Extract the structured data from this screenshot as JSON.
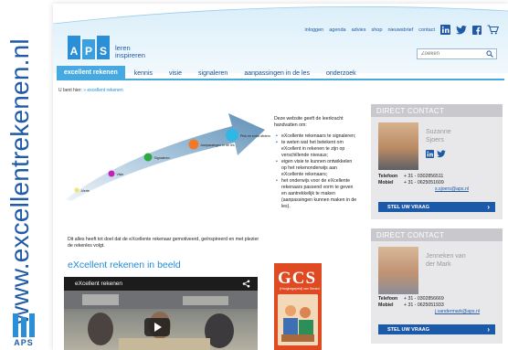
{
  "side": {
    "url": "www.excellentrekenen.nl",
    "logo_text": "APS"
  },
  "header": {
    "logo_letters": [
      "A",
      "P",
      "S"
    ],
    "logo_tagline_1": "leren",
    "logo_tagline_2": "inspireren",
    "top_links": [
      "inloggen",
      "agenda",
      "advies",
      "shop",
      "nieuwsbrief",
      "contact"
    ],
    "search_placeholder": "Zoeken"
  },
  "nav": {
    "items": [
      "excellent rekenen",
      "kennis",
      "visie",
      "signaleren",
      "aanpassingen in de les",
      "onderzoek"
    ],
    "active_index": 0
  },
  "breadcrumb": {
    "prefix": "U bent hier:",
    "link": "» excellent rekenen"
  },
  "diagram": {
    "labels": [
      "Alerte",
      "Visie",
      "Signaleren",
      "Aanpassingen in de les",
      "Plek en extra afstemde programma's"
    ],
    "colors": [
      "#f2e46a",
      "#c71fb8",
      "#2fa844",
      "#f07a2a",
      "#2fb8e6"
    ]
  },
  "intro": {
    "lead": "Deze website geeft de leerkracht handvatten om:",
    "bullets": [
      "eXcellente rekenaars te signaleren;",
      "te weten wat het betekent om eXcellent in rekenen te zijn op verschillende niveaus;",
      "eigen visie te kunnen ontwikkelen op het rekenonderwijs aan eXcellente rekenaars;",
      "het onderwijs voor de eXcellente rekenaars passend vorm te geven en aantrekkelijk te maken (aanpassingen kunnen maken in de les)."
    ]
  },
  "body_text": "Dit alles heeft tot doel dat de eXcellente rekenaar gemotiveerd, geïnspireerd en met plezier de rekenles volgt.",
  "section_title": "eXcellent rekenen in beeld",
  "video": {
    "title": "eXcellent rekenen"
  },
  "book": {
    "letters": "GCS",
    "subtitle": "(Hooghegepeld) van Gerard"
  },
  "contacts": [
    {
      "heading": "DIRECT CONTACT",
      "name_line1": "Suzanne",
      "name_line2": "Sjoers",
      "phone_label": "Telefoon",
      "phone_value": "+ 31 - 0302856511",
      "mobile_label": "Mobiel",
      "mobile_value": "+ 31 - 0625051609",
      "email": "s.sjoers@aps.nl",
      "button": "STEL UW VRAAG"
    },
    {
      "heading": "DIRECT CONTACT",
      "name_line1": "Jenneken van",
      "name_line2": "der Mark",
      "phone_label": "Telefoon",
      "phone_value": "+ 31 - 0302856669",
      "mobile_label": "Mobiel",
      "mobile_value": "+ 31 - 0625051933",
      "email": "j.vandermark@aps.nl",
      "button": "STEL UW VRAAG"
    }
  ],
  "colors": {
    "brand_blue": "#1e5aa8",
    "nav_active": "#47a9e2",
    "button_blue": "#1a5aa8"
  }
}
